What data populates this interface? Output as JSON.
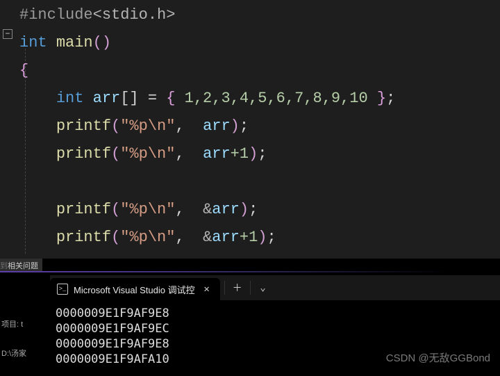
{
  "code": {
    "include_directive": "#include",
    "include_header": "<stdio.h>",
    "ret_type": "int",
    "main_name": "main",
    "open_paren": "()",
    "open_brace": "{",
    "int_kw": "int",
    "arr_name": "arr",
    "brackets": "[]",
    "equals": " = ",
    "init_open": "{ ",
    "init_values": "1,2,3,4,5,6,7,8,9,10",
    "init_close": " }",
    "semicolon": ";",
    "printf_name": "printf",
    "fmt_str": "\"%p\\n\"",
    "comma": ", ",
    "arg1": "arr",
    "arg2": "arr",
    "plus1": "+1",
    "amp": "&",
    "arg3": "arr",
    "arg4": "arr"
  },
  "panel_tab": "相关问题",
  "terminal": {
    "tab_title": "Microsoft Visual Studio 调试控",
    "lines": [
      "0000009E1F9AF9E8",
      "0000009E1F9AF9EC",
      "0000009E1F9AF9E8",
      "0000009E1F9AFA10"
    ]
  },
  "meta": {
    "project_label": "项目:",
    "project_val": "t",
    "path": "D:\\汤家"
  },
  "watermark": "CSDN @无敌GGBond"
}
